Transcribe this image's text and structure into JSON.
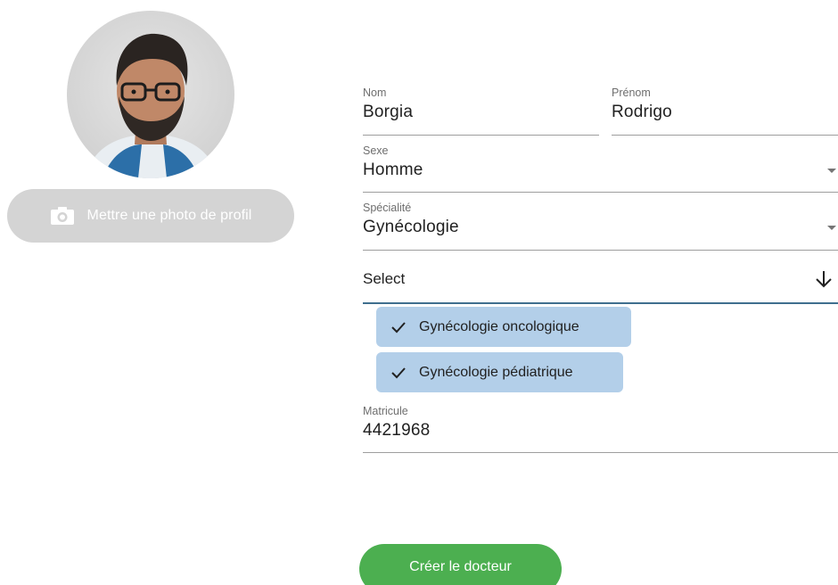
{
  "profile": {
    "photo_button_label": "Mettre une photo de profil"
  },
  "form": {
    "nom": {
      "label": "Nom",
      "value": "Borgia"
    },
    "prenom": {
      "label": "Prénom",
      "value": "Rodrigo"
    },
    "sexe": {
      "label": "Sexe",
      "value": "Homme"
    },
    "specialite": {
      "label": "Spécialité",
      "value": "Gynécologie"
    },
    "sous_specialite_select": {
      "label": "Select"
    },
    "selected_sous_specialites": [
      {
        "label": "Gynécologie oncologique"
      },
      {
        "label": "Gynécologie pédiatrique"
      }
    ],
    "matricule": {
      "label": "Matricule",
      "value": "4421968"
    }
  },
  "actions": {
    "create_label": "Créer le docteur"
  },
  "colors": {
    "photo_button_bg": "#d4d4d4",
    "chip_bg": "#b3cfe9",
    "create_button_bg": "#4caf50",
    "select_underline": "#3f6f8e"
  },
  "icons": {
    "photo_button": "camera-icon",
    "select": "arrow-down-icon",
    "chip": "check-icon",
    "dropdown": "caret-icon"
  }
}
